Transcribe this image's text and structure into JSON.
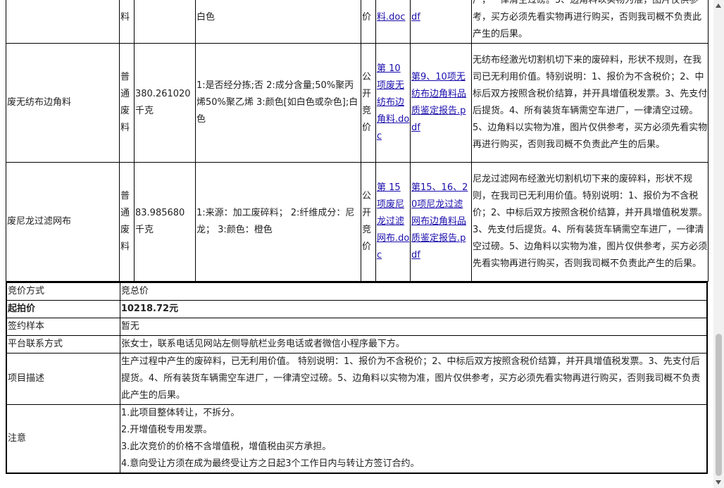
{
  "rows": [
    {
      "name": "",
      "type": "料",
      "qty": "",
      "spec": "白色",
      "method": "价",
      "doc": "料.doc",
      "report": "df",
      "desc": "厂，一律清空过磅。5、边角料以实物为准，图片仅供参考，买方必须先看实物再进行购买，否则我司概不负责此产生的后果。"
    },
    {
      "name": "废无纺布边角料",
      "type": "普通废料",
      "qty": "380.261020千克",
      "spec": "1:是否经分拣;否 2:成分含量;50%聚丙烯50%聚乙烯 3:颜色[如白色或杂色];白色",
      "method": "公开竞价",
      "doc": "第 10 项废无纺布边角料.doc",
      "report": "第9、10项无纺布边角料品质鉴定报告.pdf",
      "desc": "无纺布经激光切割机切下来的废碎料，形状不规则，在我司已无利用价值。特别说明：1、报价为不含税价；2、中标后双方按照含税价结算，并开具增值税发票。3、先支付后提货。4、所有装货车辆需空车进厂，一律清空过磅。5、边角料以实物为准，图片仅供参考，买方必须先看实物再进行购买，否则我司概不负责此产生的后果。"
    },
    {
      "name": "废尼龙过滤网布",
      "type": "普通废料",
      "qty": "83.985680 千克",
      "spec": "1:来源：加工废碎料； 2:纤维成分：尼龙； 3:颜色：橙色",
      "method": "公开竞价",
      "doc": "第 15 项废尼龙过滤网布.doc",
      "report": "第15、16、20项尼龙过滤网布边角料品质鉴定报告.pdf",
      "desc": "尼龙过滤网布经激光切割机切下来的废碎料，形状不规则，在我司已无利用价值。特别说明：1、报价为不含税价；2、中标后双方按照含税价结算，并开具增值税发票。3、先支付后提货。4、所有装货车辆需空车进厂，一律清空过磅。5、边角料以实物为准，图片仅供参考，买方必须先看实物再进行购买，否则我司概不负责此产生的后果。"
    }
  ],
  "info": {
    "bid_method_label": "竞价方式",
    "bid_method_value": "竞总价",
    "start_price_label": "起拍价",
    "start_price_value": "10218.72元",
    "contract_label": "签约样本",
    "contract_value": "暂无",
    "contact_label": "平台联系方式",
    "contact_value": "张女士，联系电话见网站左侧导航栏业务电话或者微信小程序最下方。",
    "desc_label": "项目描述",
    "desc_value": "生产过程中产生的废碎料，已无利用价值。 特别说明：1、报价为不含税价；2、中标后双方按照含税价结算，并开具增值税发票。3、先支付后提货。4、所有装货车辆需空车进厂，一律清空过磅。5、边角料以实物为准，图片仅供参考，买方必须先看实物再进行购买，否则我司概不负责此产生的后果。",
    "notice_label": "注意",
    "notices": [
      "1.此项目整体转让，不拆分。",
      "2.开增值税专用发票。",
      "3.此次竞价的价格不含增值税，增值税由买方承担。",
      "4.意向受让方须在成为最终受让方之日起3个工作日内与转让方签订合约。"
    ]
  }
}
